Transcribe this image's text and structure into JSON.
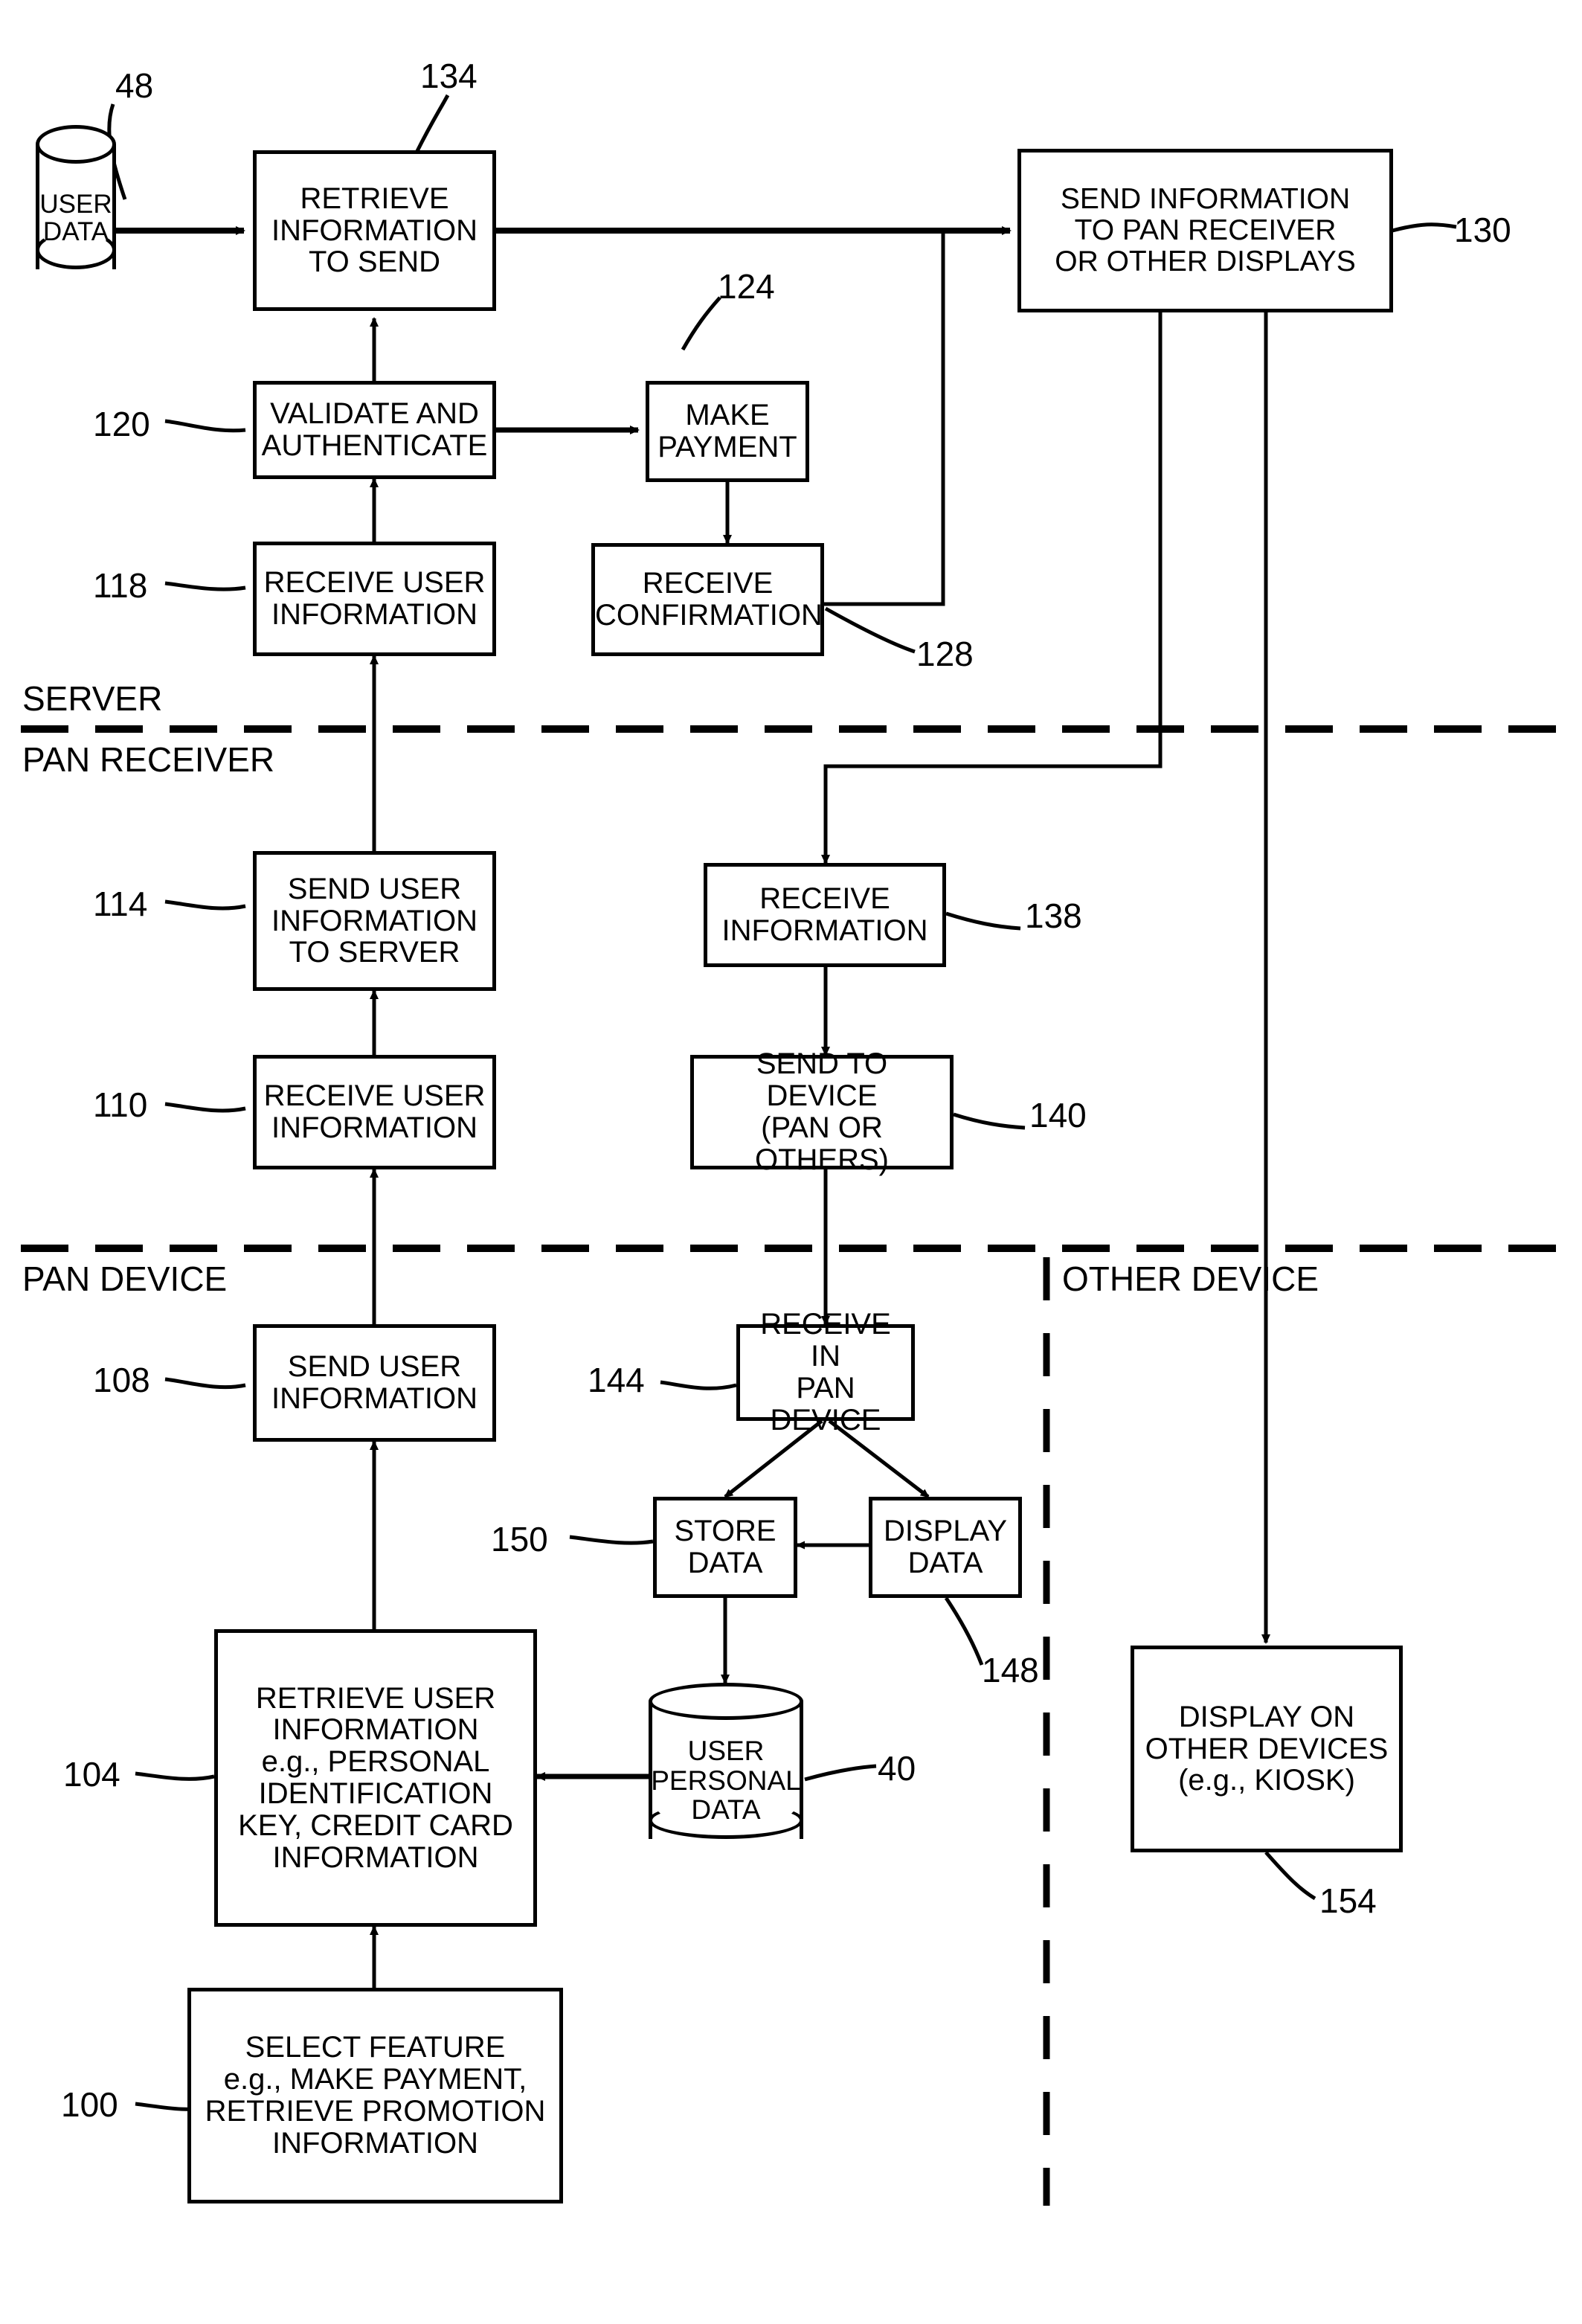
{
  "figure": {
    "type": "patent-flowchart",
    "swimlanes": [
      {
        "id": "server",
        "label": "SERVER"
      },
      {
        "id": "pan-receiver",
        "label": "PAN RECEIVER"
      },
      {
        "id": "pan-device",
        "label": "PAN DEVICE"
      },
      {
        "id": "other-device",
        "label": "OTHER DEVICE"
      }
    ],
    "nodes": [
      {
        "id": "n48",
        "ref": "48",
        "shape": "cylinder",
        "text": "USER\nDATA"
      },
      {
        "id": "n134",
        "ref": "134",
        "shape": "rect",
        "text": "RETRIEVE\nINFORMATION\nTO SEND"
      },
      {
        "id": "n130",
        "ref": "130",
        "shape": "rect",
        "text": "SEND INFORMATION\nTO PAN RECEIVER\nOR OTHER DISPLAYS"
      },
      {
        "id": "n120",
        "ref": "120",
        "shape": "rect",
        "text": "VALIDATE AND\nAUTHENTICATE"
      },
      {
        "id": "n124",
        "ref": "124",
        "shape": "rect",
        "text": "MAKE\nPAYMENT"
      },
      {
        "id": "n118",
        "ref": "118",
        "shape": "rect",
        "text": "RECEIVE USER\nINFORMATION"
      },
      {
        "id": "n128",
        "ref": "128",
        "shape": "rect",
        "text": "RECEIVE\nCONFIRMATION"
      },
      {
        "id": "n114",
        "ref": "114",
        "shape": "rect",
        "text": "SEND USER\nINFORMATION\nTO SERVER"
      },
      {
        "id": "n138",
        "ref": "138",
        "shape": "rect",
        "text": "RECEIVE\nINFORMATION"
      },
      {
        "id": "n110",
        "ref": "110",
        "shape": "rect",
        "text": "RECEIVE USER\nINFORMATION"
      },
      {
        "id": "n140",
        "ref": "140",
        "shape": "rect",
        "text": "SEND TO DEVICE\n(PAN OR OTHERS)"
      },
      {
        "id": "n108",
        "ref": "108",
        "shape": "rect",
        "text": "SEND USER\nINFORMATION"
      },
      {
        "id": "n144",
        "ref": "144",
        "shape": "rect",
        "text": "RECEIVE IN\nPAN DEVICE"
      },
      {
        "id": "n150",
        "ref": "150",
        "shape": "rect",
        "text": "STORE\nDATA"
      },
      {
        "id": "n148",
        "ref": "148",
        "shape": "rect",
        "text": "DISPLAY\nDATA"
      },
      {
        "id": "n154",
        "ref": "154",
        "shape": "rect",
        "text": "DISPLAY ON\nOTHER DEVICES\n(e.g., KIOSK)"
      },
      {
        "id": "n104",
        "ref": "104",
        "shape": "rect",
        "text": "RETRIEVE USER\nINFORMATION\ne.g., PERSONAL\nIDENTIFICATION\nKEY, CREDIT CARD\nINFORMATION"
      },
      {
        "id": "n40",
        "ref": "40",
        "shape": "cylinder",
        "text": "USER\nPERSONAL\nDATA"
      },
      {
        "id": "n100",
        "ref": "100",
        "shape": "rect",
        "text": "SELECT FEATURE\ne.g., MAKE PAYMENT,\nRETRIEVE PROMOTION\nINFORMATION"
      }
    ]
  },
  "labels": {
    "n48": "48",
    "n134": "134",
    "n130": "130",
    "n120": "120",
    "n124": "124",
    "n118": "118",
    "n128": "128",
    "n114": "114",
    "n138": "138",
    "n110": "110",
    "n140": "140",
    "n108": "108",
    "n144": "144",
    "n150": "150",
    "n148": "148",
    "n154": "154",
    "n104": "104",
    "n40": "40",
    "n100": "100"
  },
  "boxes": {
    "n48": "USER\nDATA",
    "n134": "RETRIEVE\nINFORMATION\nTO SEND",
    "n130": "SEND INFORMATION\nTO PAN RECEIVER\nOR OTHER DISPLAYS",
    "n120": "VALIDATE AND\nAUTHENTICATE",
    "n124": "MAKE\nPAYMENT",
    "n118": "RECEIVE USER\nINFORMATION",
    "n128": "RECEIVE\nCONFIRMATION",
    "n114": "SEND USER\nINFORMATION\nTO SERVER",
    "n138": "RECEIVE\nINFORMATION",
    "n110": "RECEIVE USER\nINFORMATION",
    "n140": "SEND TO DEVICE\n(PAN OR OTHERS)",
    "n108": "SEND USER\nINFORMATION",
    "n144": "RECEIVE IN\nPAN DEVICE",
    "n150": "STORE\nDATA",
    "n148": "DISPLAY\nDATA",
    "n154": "DISPLAY ON\nOTHER DEVICES\n(e.g., KIOSK)",
    "n104": "RETRIEVE USER\nINFORMATION\ne.g., PERSONAL\nIDENTIFICATION\nKEY, CREDIT CARD\nINFORMATION",
    "n40": "USER\nPERSONAL\nDATA",
    "n100": "SELECT FEATURE\ne.g., MAKE PAYMENT,\nRETRIEVE PROMOTION\nINFORMATION"
  },
  "swimlane_labels": {
    "server": "SERVER",
    "pan_receiver": "PAN RECEIVER",
    "pan_device": "PAN DEVICE",
    "other_device": "OTHER DEVICE"
  },
  "colors": {
    "ink": "#000000",
    "paper": "#ffffff"
  }
}
